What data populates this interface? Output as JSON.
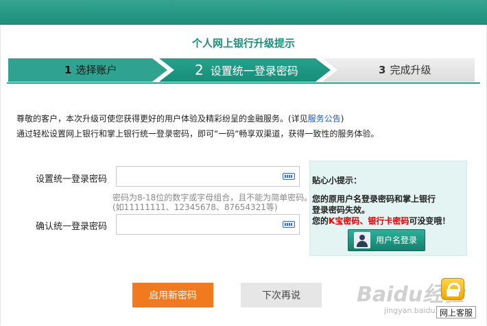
{
  "header": {
    "title": "个人网上银行升级提示"
  },
  "steps": [
    {
      "num": "1",
      "label": "选择账户"
    },
    {
      "num": "2",
      "label": "设置统一登录密码"
    },
    {
      "num": "3",
      "label": "完成升级"
    }
  ],
  "intro": {
    "line1_text": "尊敬的客户，本次升级可使您获得更好的用户体验及精彩纷呈的金融服务。(详见",
    "line1_link": "服务公告",
    "line1_end": ")",
    "line2": "通过轻松设置网上银行和掌上银行统一登录密码，即可“一码“畅享双渠道，获得一致性的服务体验。"
  },
  "form": {
    "password_label": "设置统一登录密码",
    "password_value": "",
    "hint_line1": "密码为8-18位的数字或字母组合，且不能为简单密码。",
    "hint_line2": "(如11111111、12345678、87654321等)",
    "confirm_label": "确认统一登录密码",
    "confirm_value": ""
  },
  "tips": {
    "title": "贴心小提示：",
    "line1": "您的原用户名登录密码和掌上银行",
    "line2": "登录密码失效。",
    "line3_pre": "您的",
    "line3_red": "K宝密码、银行卡密码",
    "line3_post": "可没变哦！",
    "button_label": "用户名登录"
  },
  "buttons": {
    "enable": "启用新密码",
    "later": "下次再说"
  },
  "service": {
    "label": "网上客服"
  },
  "watermark": {
    "main": "Baidu经验",
    "sub": "jingyan.baidu.com"
  },
  "colors": {
    "brand_teal": "#1d8f7a",
    "accent_orange": "#f07a1d",
    "tip_red": "#e00000"
  }
}
